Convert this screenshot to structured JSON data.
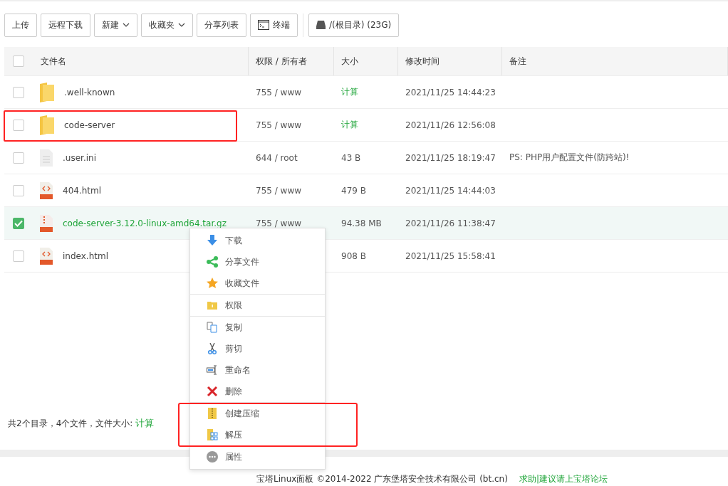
{
  "toolbar": [
    {
      "label": "上传",
      "kind": "plain"
    },
    {
      "label": "远程下载",
      "kind": "plain"
    },
    {
      "label": "新建",
      "kind": "dropdown"
    },
    {
      "label": "收藏夹",
      "kind": "dropdown"
    },
    {
      "label": "分享列表",
      "kind": "plain"
    },
    {
      "label": "终端",
      "kind": "terminal"
    },
    {
      "label": "/(根目录) (23G)",
      "kind": "disk"
    }
  ],
  "table": {
    "select_all": false,
    "columns": [
      "文件名",
      "权限 / 所有者",
      "大小",
      "修改时间",
      "备注"
    ],
    "rows": [
      {
        "kind": "folder",
        "name": ".well-known",
        "perm": "755 / www",
        "size": "计算",
        "time": "2021/11/25 14:44:23",
        "selected": false,
        "highlighted": false
      },
      {
        "kind": "folder",
        "name": "code-server",
        "perm": "755 / www",
        "size": "计算",
        "time": "2021/11/26 12:56:08",
        "selected": false,
        "highlighted": true
      },
      {
        "kind": "text",
        "name": ".user.ini",
        "perm": "644 / root",
        "size": "43 B",
        "time": "2021/11/25 18:19:47",
        "note": "PS: PHP用户配置文件(防跨站)!",
        "selected": false,
        "highlighted": false
      },
      {
        "kind": "html",
        "name": "404.html",
        "perm": "755 / www",
        "size": "479 B",
        "time": "2021/11/25 14:44:03",
        "selected": false,
        "highlighted": false
      },
      {
        "kind": "archive",
        "name": "code-server-3.12.0-linux-amd64.tar.gz",
        "perm": "755 / www",
        "size": "94.38 MB",
        "time": "2021/11/26 11:38:47",
        "selected": true,
        "highlighted": false
      },
      {
        "kind": "html",
        "name": "index.html",
        "size": "908 B",
        "time": "2021/11/25 15:58:41",
        "selected": false,
        "highlighted": false
      }
    ]
  },
  "summary": {
    "text": "共2个目录，4个文件，文件大小:",
    "link": "计算"
  },
  "context_menu": [
    {
      "highlighted": false,
      "items": [
        "下载",
        "分享文件",
        "收藏文件"
      ]
    },
    {
      "highlighted": false,
      "items": [
        "权限"
      ]
    },
    {
      "highlighted": false,
      "items": [
        "复制",
        "剪切",
        "重命名",
        "删除"
      ]
    },
    {
      "highlighted": true,
      "items": [
        "创建压缩",
        "解压"
      ]
    },
    {
      "highlighted": false,
      "items": [
        "属性"
      ]
    }
  ],
  "footer": {
    "copyright": "宝塔Linux面板 ©2014-2022 广东堡塔安全技术有限公司 (bt.cn)",
    "link": "求助|建议请上宝塔论坛"
  }
}
